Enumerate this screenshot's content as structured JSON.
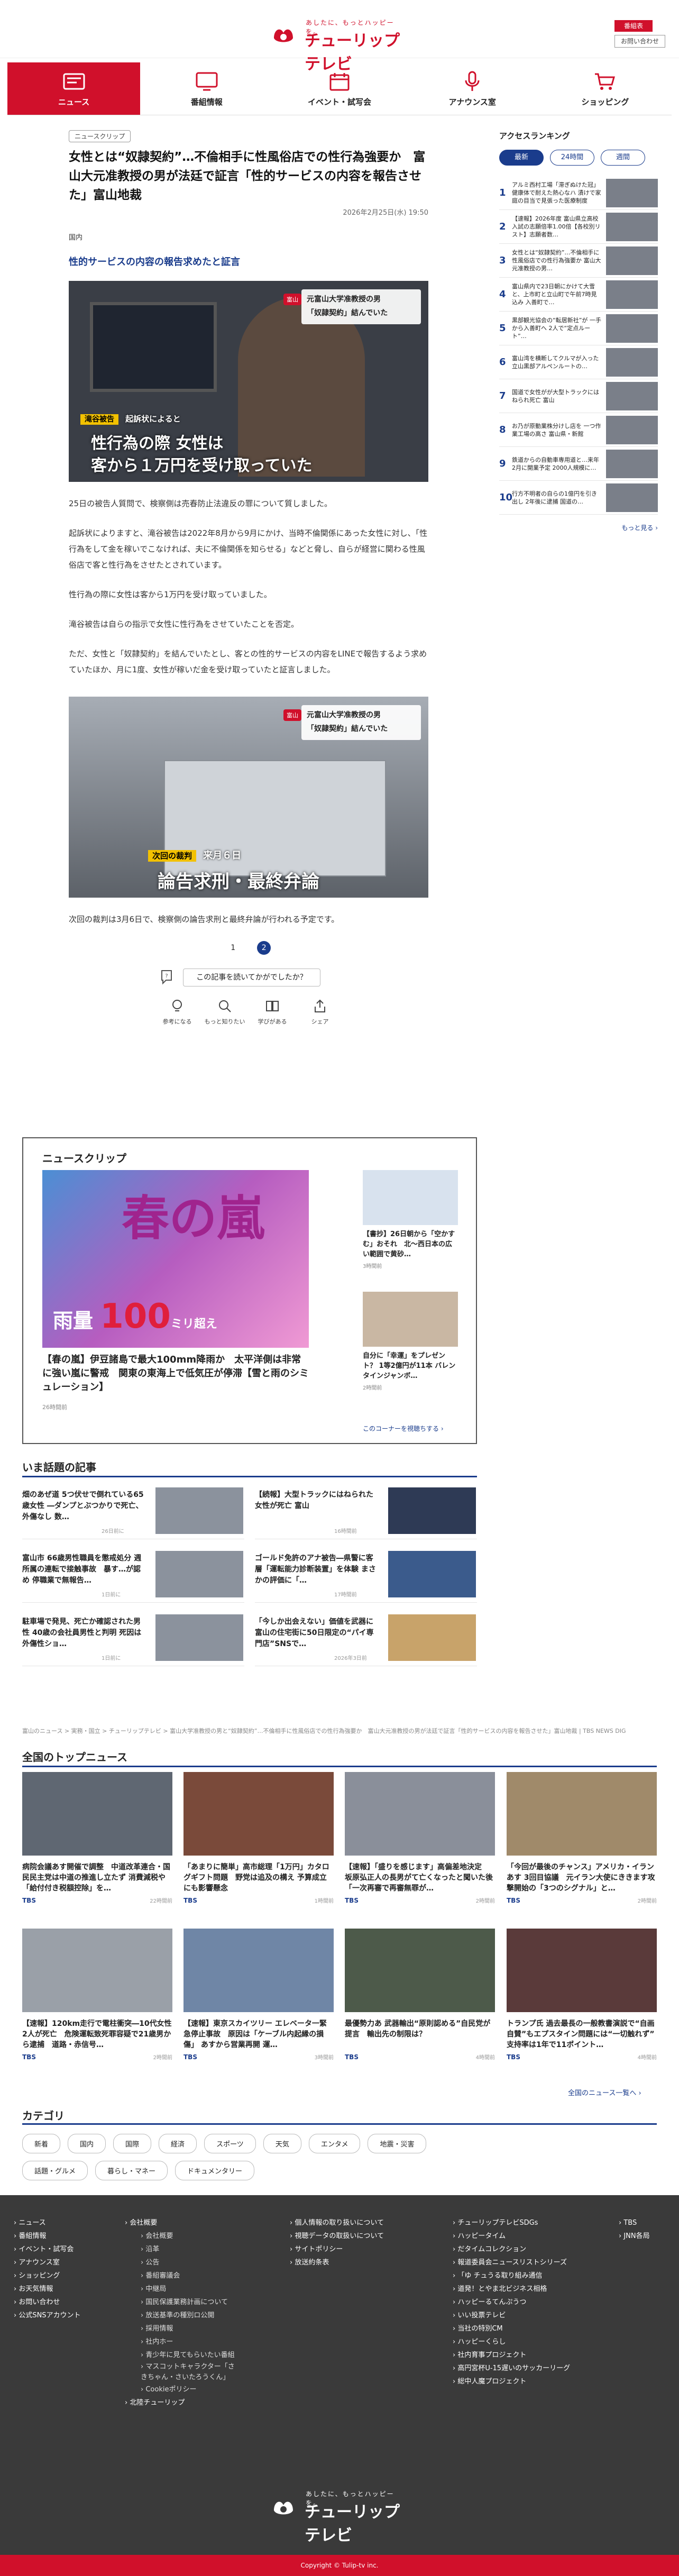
{
  "site": {
    "tagline": "あしたに、もっとハッピーを。",
    "name": "チューリップテレビ",
    "login_label": "番組表",
    "contact_label": "お問い合わせ"
  },
  "gnav": [
    {
      "label": "ニュース",
      "icon": "news-icon"
    },
    {
      "label": "番組情報",
      "icon": "tv-icon"
    },
    {
      "label": "イベント・試写会",
      "icon": "event-icon"
    },
    {
      "label": "アナウンス室",
      "icon": "mic-icon"
    },
    {
      "label": "ショッピング",
      "icon": "cart-icon"
    }
  ],
  "article": {
    "category": "ニュースクリップ",
    "headline": "女性とは“奴隷契約”…不倫相手に性風俗店での性行為強要か　富山大元准教授の男が法廷で証言「性的サービスの内容を報告させた」富山地裁",
    "date": "2026年2月25日(水) 19:50",
    "genre": "国内",
    "subhead": "性的サービスの内容の報告求めたと証言",
    "photo1": {
      "tag_label": "富山",
      "caption_small": "元富山大学准教授の男",
      "caption_small2": "「奴隷契約」結んでいた",
      "lower_tag": "滝谷被告",
      "lower_small": "起訴状によると",
      "lower_big1": "性行為の際 女性は",
      "lower_big2": "客から１万円を受け取っていた"
    },
    "paragraphs": [
      "25日の被告人質問で、検察側は売春防止法違反の罪について質しました。",
      "起訴状によりますと、滝谷被告は2022年8月から9月にかけ、当時不倫関係にあった女性に対し、「性行為をして金を稼いでこなければ、夫に不倫関係を知らせる」などと脅し、自らが経営に関わる性風俗店で客と性行為をさせたとされています。",
      "性行為の際に女性は客から1万円を受け取っていました。",
      "滝谷被告は自らの指示で女性に性行為をさせていたことを否定。",
      "ただ、女性と「奴隷契約」を結んでいたとし、客との性的サービスの内容をLINEで報告するよう求めていたほか、月に1度、女性が稼いだ金を受け取っていたと証言しました。"
    ],
    "photo2": {
      "tag_label": "富山",
      "caption_small": "元富山大学准教授の男",
      "caption_small2": "「奴隷契約」結んでいた",
      "lower_tag": "次回の裁判",
      "lower_date": "来月６日",
      "lower_big": "論告求刑・最終弁論"
    },
    "last_paragraph": "次回の裁判は3月6日で、検察側の論告求刑と最終弁論が行われる予定です。",
    "pages": [
      "1",
      "2"
    ],
    "reaction_question": "この記事を読いてかがでしたか？",
    "reactions": [
      {
        "label": "参考になる",
        "icon": "bulb-icon"
      },
      {
        "label": "もっと知りたい",
        "icon": "search-icon"
      },
      {
        "label": "学びがある",
        "icon": "book-icon"
      },
      {
        "label": "シェア",
        "icon": "share-icon"
      }
    ]
  },
  "ranking": {
    "title": "アクセスランキング",
    "tabs": [
      "最新",
      "24時間",
      "週間"
    ],
    "items": [
      {
        "n": "1",
        "title": "アルミ西村工場「滞ぎぬけた冠」健康体で耐えた熱心なハ 漬けで家庭の目当で見張った医療制度"
      },
      {
        "n": "2",
        "title": "【速報】2026年度 富山県立高校入試の志願倍率1.00倍【各校別リスト】志願者数…"
      },
      {
        "n": "3",
        "title": "女性とは“奴隷契約”…不倫相手に性風俗店での性行為強要か 富山大元准教授の男…"
      },
      {
        "n": "4",
        "title": "富山県内で23日朝にかけて大雪と、上市町と立山町で午前7時見込み 入善町で…"
      },
      {
        "n": "5",
        "title": "黒部観光協会の“転居新社”が 一手から入善町へ 2人で“定点ルート”…"
      },
      {
        "n": "6",
        "title": "富山湾を横断してクルマが入った 立山黒部アルペンルートの…"
      },
      {
        "n": "7",
        "title": "国道で女性がが大型トラックにはねられ死亡 富山"
      },
      {
        "n": "8",
        "title": "お乃が原動業株分けし店を 一つ作業工場の高さ 富山県・新館"
      },
      {
        "n": "9",
        "title": "鉄道からの自動車専用道と…来年2月に開業予定 2000人規模に…"
      },
      {
        "n": "10",
        "title": "行方不明者の自らの1億円を引き出し 2年後に逮捕 国道の…"
      }
    ],
    "more": "もっと見る ›"
  },
  "clip": {
    "title": "ニュースクリップ",
    "big_text": "春の嵐",
    "rain_label": "雨量",
    "rain_value": "100",
    "rain_unit": "ミリ超え",
    "big_caption": "【春の嵐】伊豆諸島で最大100mm降雨か　太平洋側は非常に強い嵐に警戒　関東の東海上で低気圧が停滞【雪と雨のシミュレーション】",
    "big_date": "26時間前",
    "small1": {
      "caption": "【書抄】26日朝から「空かすむ」おそれ　北～西日本の広い範囲で黄砂…",
      "date": "3時間前"
    },
    "small2": {
      "caption": "自分に「幸運」をプレゼント？ 1等2億円が11本 バレンタインジャンボ…",
      "date": "2時間前"
    },
    "link": "このコーナーを視聴ちする ›"
  },
  "trending": {
    "title": "いま話題の記事",
    "items": [
      {
        "title": "畑のあぜ道 5つ伏せで倒れている65歳女性 ―ダンプとぶつかりで死亡、外傷なし 数…",
        "date": "26日前に"
      },
      {
        "title": "【続報】大型トラックにはねられた女性が死亡 富山",
        "date": "16時間前"
      },
      {
        "title": "富山市 66歳男性職員を懲戒処分 週所属の連転で接触事故　暴す…が認め 停職業で無報告…",
        "date": "1日前に"
      },
      {
        "title": "ゴールド免許のアナ被告―県警に客層「運転能力診断装置」を体験 まさかの評価に「…",
        "date": "17時間前"
      },
      {
        "title": "駐車場で発見、死亡か確認された男性 40歳の会社員男性と判明 死因は外傷性ショ…",
        "date": "1日前に"
      },
      {
        "title": "「今しか出会えない」価値を武器に 富山の住宅街に50日限定の“パイ専門店”SNSで…",
        "date": "2026年3日前"
      }
    ]
  },
  "breadcrumb": "富山のニュース > 実務・国立 > チューリップテレビ > 富山大学准教授の男と“奴隷契約”…不倫相手に性風俗店での性行為強要か　富山大元准教授の男が法廷で証言「性的サービスの内容を報告させた」富山地裁 | TBS NEWS DIG",
  "national": {
    "title": "全国のトップニュース",
    "items": [
      {
        "title": "病院会議あす開催で調整　中道改革連合・国民民主党は中道の推進し立たず 消費減税や「給付付き税額控除」を…",
        "src": "TBS",
        "date": "22時間前"
      },
      {
        "title": "「あまりに簡単」高市総理「1万円」カタログギフト問題　野党は追及の構え 予算成立にも影響懸念",
        "src": "TBS",
        "date": "1時間前"
      },
      {
        "title": "【速報】「盛りを感じます」高偏差地決定　坂原弘正人の長男がて亡くなったと聞いた後「一次再審で再審無罪が…",
        "src": "TBS",
        "date": "2時間前"
      },
      {
        "title": "「今回が最後のチャンス」アメリカ・イランあす 3回目協議　元イラン大使にききます攻撃開始の「3つのシグナル」と…",
        "src": "TBS",
        "date": "2時間前"
      },
      {
        "title": "【速報】120km走行で電柱衝突―10代女性2人が死亡　危険運転致死罪容疑で21歳男から逮捕　道路・赤信号…",
        "src": "TBS",
        "date": "2時間前"
      },
      {
        "title": "【速報】東京スカイツリー エレベータ一緊急停止事故　原因は「ケーブル内起縁の損傷」 あすから営業再開 運…",
        "src": "TBS",
        "date": "3時間前"
      },
      {
        "title": "最優勢力あ 武器輸出“原則認める”自民党が提言　輸出先の制限は？",
        "src": "TBS",
        "date": "4時間前"
      },
      {
        "title": "トランプ氏 過去最長の一般教書演説で“自画自賛”もエプスタイン問題には“一切触れず” 支持率は1年で11ポイント…",
        "src": "TBS",
        "date": "4時間前"
      }
    ],
    "all_link": "全国のニュース一覧へ ›"
  },
  "categories": {
    "title": "カテゴリ",
    "items": [
      "新着",
      "国内",
      "国際",
      "経済",
      "スポーツ",
      "天気",
      "エンタメ",
      "地震・災害",
      "話題・グルメ",
      "暮らし・マネー",
      "ドキュメンタリー"
    ]
  },
  "footer": {
    "col1": [
      "› ニュース",
      "› 番組情報",
      "› イベント・試写会",
      "› アナウンス室",
      "› ショッピング",
      "› お天気情報",
      "› お問い合わせ",
      "› 公式SNSアカウント"
    ],
    "col2_main": "› 会社概要",
    "col2_sub": [
      "› 会社概要",
      "› 沿革",
      "› 公告",
      "› 番組審議会",
      "› 中継局",
      "› 国民保護業務計画について",
      "› 放送基準の種別ロ公開",
      "› 採用情報",
      "› 社内ホー",
      "› 青少年に見てもらいたい番組",
      "› マスコットキャラクター「さきちゃん・さいたろうくん」",
      "› Cookieポリシー"
    ],
    "col2_last": "› 北陸チューリップ",
    "col3": [
      "› 個人情報の取り扱いについて",
      "› 視聴データの取扱いについて",
      "› サイトポリシー",
      "› 放送約条表"
    ],
    "col4": [
      "› チューリップテレビSDGs",
      "› ハッピータイム",
      "› だタイムコレクション",
      "› 報道委員会ニュースリストシリーズ",
      "› 「ゆ チュうる取り組み通信",
      "› 道発！とやま北ビジネス相格",
      "› ハッピーるてんぷうつ",
      "› いい投票テレビ",
      "› 当社の特別CM",
      "› ハッピーくらし",
      "› 社内育事プロジェクト",
      "› 高円宮杯U-15遅いのサッカーリーグ",
      "› 総中人魔プロジェクト"
    ],
    "col5": [
      "› TBS",
      "› JNN各局"
    ],
    "copyright": "Copyright © Tulip-tv inc."
  },
  "colors": {
    "brand": "#d0102b",
    "accent": "#1a3c8c"
  }
}
